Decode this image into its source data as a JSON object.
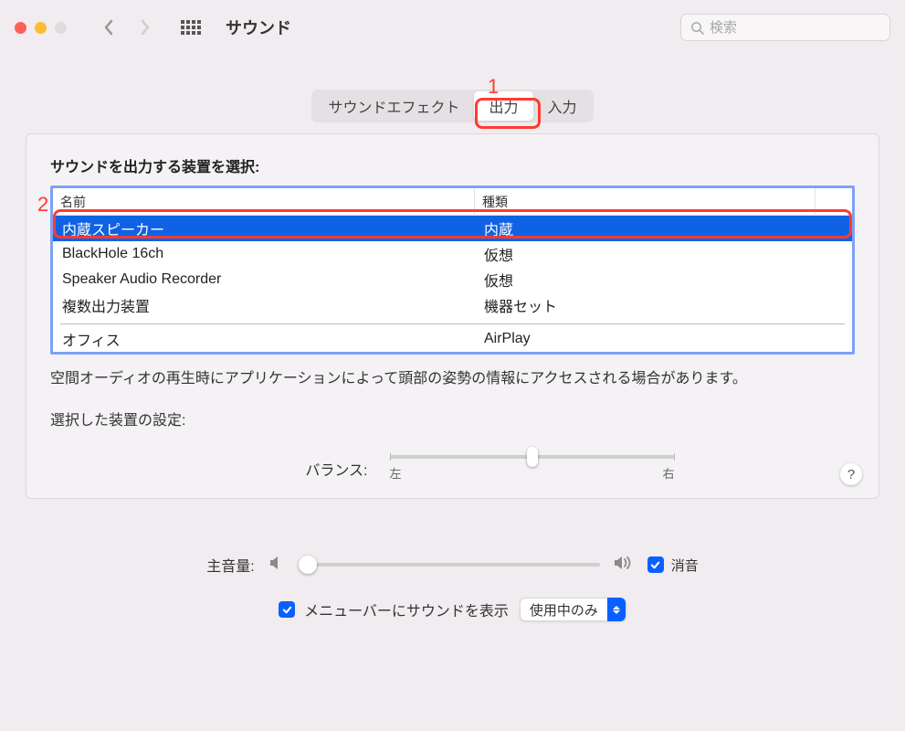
{
  "window": {
    "title": "サウンド",
    "search_placeholder": "検索"
  },
  "tabs": {
    "effects": "サウンドエフェクト",
    "output": "出力",
    "input": "入力"
  },
  "annotations": {
    "a1": "1",
    "a2": "2"
  },
  "output": {
    "select_label": "サウンドを出力する装置を選択:",
    "col_name": "名前",
    "col_type": "種類",
    "devices": [
      {
        "name": "内蔵スピーカー",
        "type": "内蔵",
        "selected": true
      },
      {
        "name": "BlackHole 16ch",
        "type": "仮想",
        "selected": false
      },
      {
        "name": "Speaker Audio Recorder",
        "type": "仮想",
        "selected": false
      },
      {
        "name": "複数出力装置",
        "type": "機器セット",
        "selected": false
      }
    ],
    "airplay": {
      "name": "オフィス",
      "type": "AirPlay"
    },
    "spatial_note": "空間オーディオの再生時にアプリケーションによって頭部の姿勢の情報にアクセスされる場合があります。",
    "settings_label": "選択した装置の設定:",
    "balance_label": "バランス:",
    "balance_left": "左",
    "balance_right": "右"
  },
  "volume": {
    "label": "主音量:",
    "mute_label": "消音"
  },
  "menubar": {
    "show_label": "メニューバーにサウンドを表示",
    "mode": "使用中のみ"
  },
  "help": "?"
}
